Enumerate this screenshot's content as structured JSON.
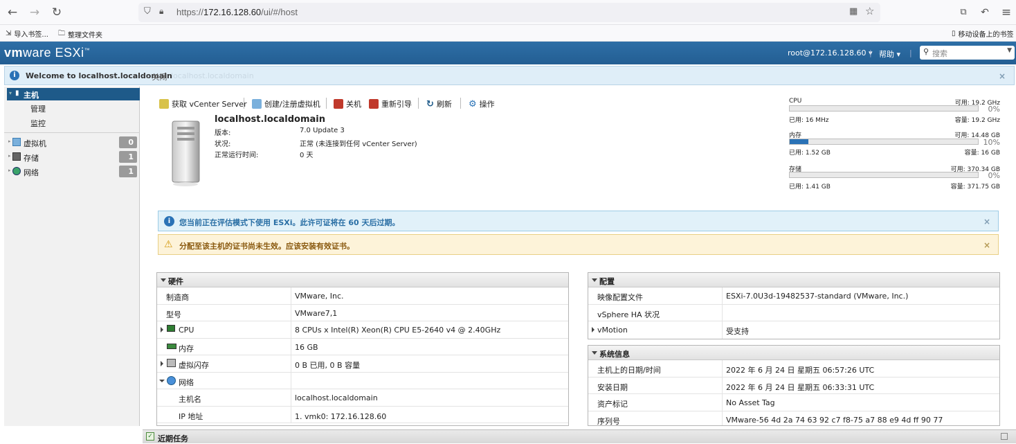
{
  "browser": {
    "url_scheme": "https://",
    "url_host": "172.16.128.60",
    "url_path": "/ui/#/host",
    "bookmarks": {
      "import": "导入书签...",
      "organize": "整理文件夹",
      "mobile": "移动设备上的书签"
    }
  },
  "topbar": {
    "logo_vm": "vm",
    "logo_ware": "ware",
    "logo_esxi": "ESXi",
    "user": "root@172.16.128.60 ▾",
    "help": "帮助 ▾",
    "search_placeholder": "搜索"
  },
  "welcome": {
    "text": "Welcome to localhost.localdomain",
    "close": "- 关闭",
    "ghost": "localhost.localdomain"
  },
  "sidebar": {
    "host": "主机",
    "manage": "管理",
    "monitor": "监控",
    "items": [
      {
        "label": "虚拟机",
        "count": "0"
      },
      {
        "label": "存储",
        "count": "1"
      },
      {
        "label": "网络",
        "count": "1"
      }
    ]
  },
  "toolbar": {
    "vcenter": "获取 vCenter Server",
    "create_vm": "创建/注册虚拟机",
    "shutdown": "关机",
    "reboot": "重新引导",
    "refresh": "刷新",
    "actions": "操作"
  },
  "host": {
    "name": "localhost.localdomain",
    "version_label": "版本:",
    "version": "7.0 Update 3",
    "state_label": "状况:",
    "state": "正常 (未连接到任何 vCenter Server)",
    "uptime_label": "正常运行时间:",
    "uptime": "0 天"
  },
  "resources": [
    {
      "name": "CPU",
      "free": "可用: 19.2 GHz",
      "pct": "0%",
      "used": "已用: 16 MHz",
      "capacity": "容量: 19.2 GHz",
      "fraction": 0.0
    },
    {
      "name": "内存",
      "free": "可用: 14.48 GB",
      "pct": "10%",
      "used": "已用: 1.52 GB",
      "capacity": "容量: 16 GB",
      "fraction": 0.1
    },
    {
      "name": "存储",
      "free": "可用: 370.34 GB",
      "pct": "0%",
      "used": "已用: 1.41 GB",
      "capacity": "容量: 371.75 GB",
      "fraction": 0.0
    }
  ],
  "alerts": {
    "info": "您当前正在评估模式下使用 ESXi。此许可证将在 60 天后过期。",
    "warning": "分配至该主机的证书尚未生效。应该安装有效证书。"
  },
  "hardware": {
    "title": "硬件",
    "rows": [
      {
        "k": "制造商",
        "v": "VMware, Inc."
      },
      {
        "k": "型号",
        "v": "VMware7,1"
      },
      {
        "k": "CPU",
        "v": "8 CPUs x Intel(R) Xeon(R) CPU E5-2640 v4 @ 2.40GHz"
      },
      {
        "k": "内存",
        "v": "16 GB"
      },
      {
        "k": "虚拟闪存",
        "v": "0 B 已用, 0 B 容量"
      },
      {
        "k": "网络",
        "v": ""
      },
      {
        "k": "主机名",
        "v": "localhost.localdomain"
      },
      {
        "k": "IP 地址",
        "v": "1. vmk0: 172.16.128.60"
      }
    ]
  },
  "config": {
    "title": "配置",
    "rows": [
      {
        "k": "映像配置文件",
        "v": "ESXi-7.0U3d-19482537-standard (VMware, Inc.)"
      },
      {
        "k": "vSphere HA 状况",
        "v": ""
      },
      {
        "k": "vMotion",
        "v": "受支持"
      }
    ]
  },
  "sysinfo": {
    "title": "系统信息",
    "rows": [
      {
        "k": "主机上的日期/时间",
        "v": "2022 年 6 月 24 日 星期五 06:57:26 UTC"
      },
      {
        "k": "安装日期",
        "v": "2022 年 6 月 24 日 星期五 06:33:31 UTC"
      },
      {
        "k": "资产标记",
        "v": "No Asset Tag"
      },
      {
        "k": "序列号",
        "v": "VMware-56 4d 2a 74 63 92 c7 f8-75 a7 88 e9 4d ff 90 77"
      }
    ]
  },
  "recent_tasks": "近期任务",
  "colors": {
    "accent": "#2a72b6",
    "header": "#235e93",
    "info_bg": "#e1f1f9",
    "warn_bg": "#fdf3d9"
  }
}
